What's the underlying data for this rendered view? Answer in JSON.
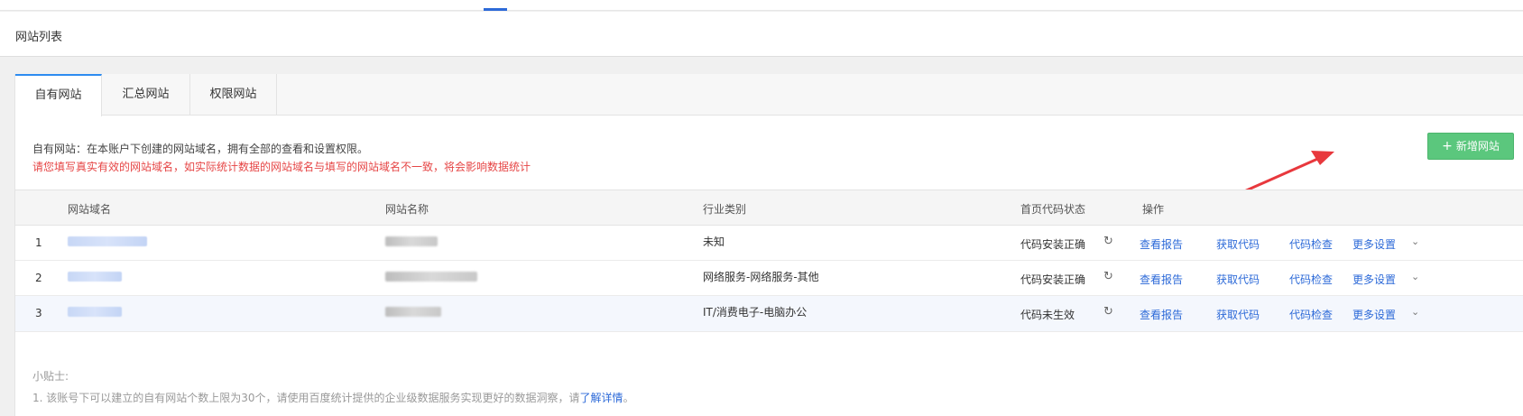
{
  "header": {
    "title": "网站列表"
  },
  "tabs": [
    {
      "label": "自有网站"
    },
    {
      "label": "汇总网站"
    },
    {
      "label": "权限网站"
    }
  ],
  "description": "自有网站：在本账户下创建的网站域名，拥有全部的查看和设置权限。",
  "warning": "请您填写真实有效的网站域名，如实际统计数据的网站域名与填写的网站域名不一致，将会影响数据统计",
  "add_button": {
    "icon": "plus-icon",
    "label": "新增网站"
  },
  "table": {
    "columns": [
      "网站域名",
      "网站名称",
      "行业类别",
      "首页代码状态",
      "操作"
    ],
    "rows": [
      {
        "index": "1",
        "industry": "未知",
        "status": "代码安装正确"
      },
      {
        "index": "2",
        "industry": "网络服务-网络服务-其他",
        "status": "代码安装正确"
      },
      {
        "index": "3",
        "industry": "IT/消费电子-电脑办公",
        "status": "代码未生效"
      }
    ],
    "actions": [
      "查看报告",
      "获取代码",
      "代码检查",
      "更多设置"
    ]
  },
  "tips": {
    "title": "小贴士:",
    "line1": "1. 该账号下可以建立的自有网站个数上限为30个，请使用百度统计提供的企业级数据服务实现更好的数据洞察，请",
    "line1_link": "了解详情",
    "line1_end": "。"
  },
  "colors": {
    "accent": "#2d6ad8",
    "add_button": "#5bc77d",
    "warning": "#e64545",
    "arrow": "#e8383d"
  }
}
